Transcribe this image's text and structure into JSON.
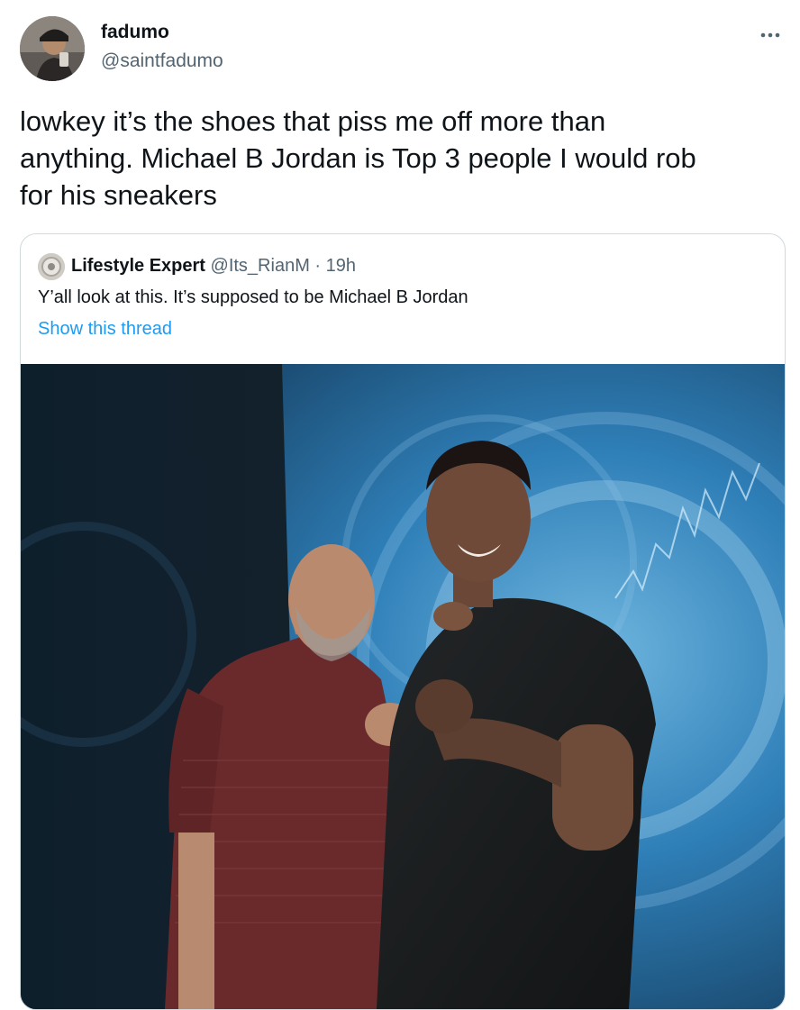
{
  "tweet": {
    "display_name": "fadumo",
    "handle": "@saintfadumo",
    "text": "lowkey it’s the shoes that piss me off more than\nanything. Michael B Jordan is Top 3 people I would rob\nfor his sneakers",
    "more_icon": "more-horizontal-icon"
  },
  "quoted_tweet": {
    "display_name": "Lifestyle Expert",
    "handle": "@Its_RianM",
    "separator": "·",
    "time": "19h",
    "text": "Y’all look at this. It’s supposed to be Michael B Jordan",
    "show_thread_label": "Show this thread"
  },
  "colors": {
    "text_primary": "#0f1419",
    "text_secondary": "#536471",
    "link_blue": "#1d9bf0",
    "border": "#cfd9de"
  }
}
